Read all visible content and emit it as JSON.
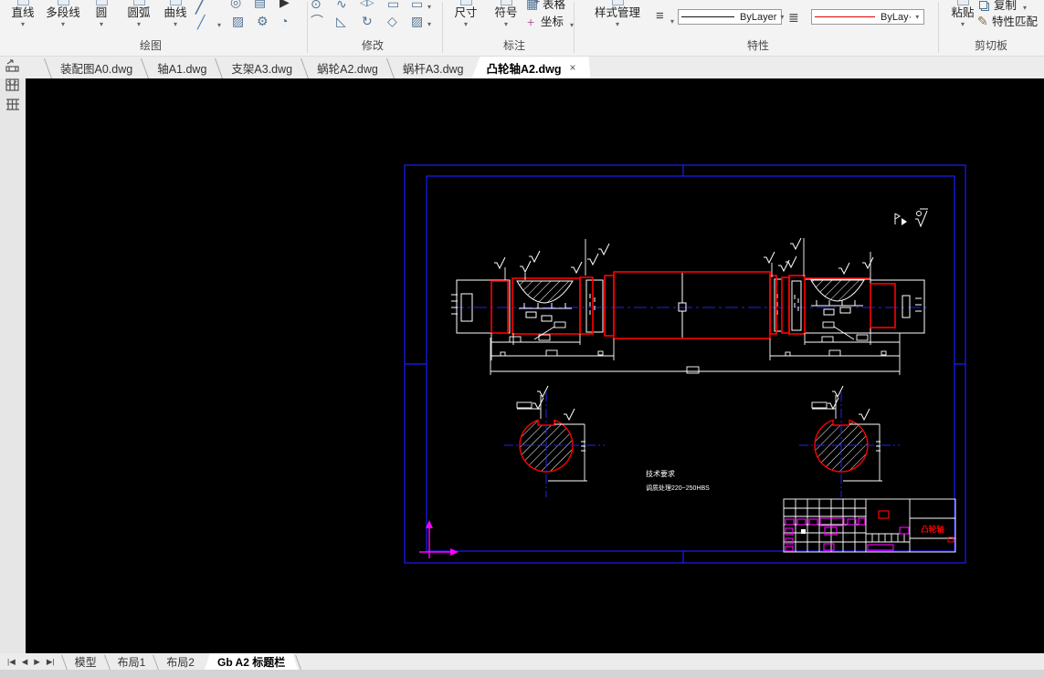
{
  "ribbon": {
    "draw": {
      "label": "绘图",
      "tools": [
        "直线",
        "多段线",
        "圆",
        "圆弧",
        "曲线"
      ]
    },
    "modify": {
      "label": "修改"
    },
    "annotate": {
      "label": "标注",
      "dimension": "尺寸",
      "symbol": "符号",
      "table": "表格",
      "coordinate": "坐标"
    },
    "properties": {
      "label": "特性",
      "style_manager": "样式管理",
      "linetype_value": "ByLayer",
      "color_value": "ByLay·"
    },
    "clipboard": {
      "label": "剪切板",
      "paste": "粘贴",
      "copy": "复制",
      "match": "特性匹配"
    }
  },
  "file_tabs": [
    "装配图A0.dwg",
    "轴A1.dwg",
    "支架A3.dwg",
    "蜗轮A2.dwg",
    "蜗杆A3.dwg",
    "凸轮轴A2.dwg"
  ],
  "active_file_tab": "凸轮轴A2.dwg",
  "drawing": {
    "notes_line1": "技术要求",
    "notes_line2": "调质处理220~250HBS",
    "title_block_name": "凸轮轴"
  },
  "layout_tabs": [
    "模型",
    "布局1",
    "布局2",
    "Gb A2 标题栏"
  ],
  "active_layout_tab": "Gb A2 标题栏",
  "icons": {
    "dropdown": "▾",
    "close": "×",
    "menu": "≡",
    "lineweight": "≣",
    "line_frag": "╱",
    "camera": "◎",
    "cabinet": "▤",
    "pointer": "▶",
    "hatch": "▨",
    "gear": "⚙",
    "pie": "◔",
    "mod1": "⊙",
    "mod2": "∿",
    "mod3": "◁▷",
    "mod4": "▭",
    "mod5": "▭",
    "mod6": "⌒",
    "mod7": "◺",
    "mod8": "↻",
    "mod9": "◇",
    "mod10": "▨",
    "table": "▦",
    "table_plus": "+",
    "coord": "+",
    "match": "✎",
    "nav_first": "|◀",
    "nav_prev": "◀",
    "nav_next": "▶",
    "nav_last": "▶|"
  },
  "colors": {
    "canvas_bg": "#000000",
    "frame_blue": "#1c1cff",
    "entity_white": "#ffffff",
    "entity_red": "#ff0000",
    "accent_magenta": "#ff00ff",
    "ribbon_bg": "#f3f3f3"
  }
}
